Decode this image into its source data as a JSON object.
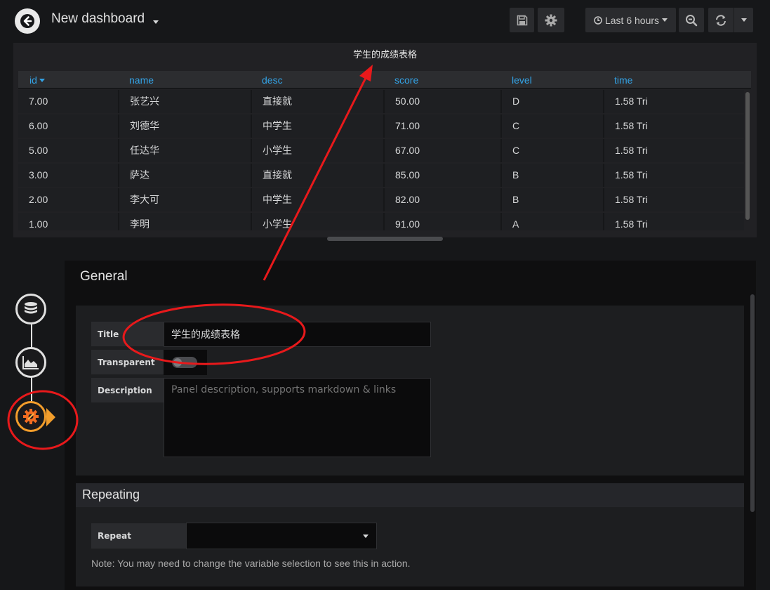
{
  "header": {
    "dashboard_title": "New dashboard",
    "time_range_label": "Last 6 hours"
  },
  "table_panel": {
    "title": "学生的成绩表格",
    "columns": [
      "id",
      "name",
      "desc",
      "score",
      "level",
      "time"
    ],
    "sorted_column": "id",
    "rows": [
      [
        "7.00",
        "张艺兴",
        "直接就",
        "50.00",
        "D",
        "1.58 Tri"
      ],
      [
        "6.00",
        "刘德华",
        "中学生",
        "71.00",
        "C",
        "1.58 Tri"
      ],
      [
        "5.00",
        "任达华",
        "小学生",
        "67.00",
        "C",
        "1.58 Tri"
      ],
      [
        "3.00",
        "萨达",
        "直接就",
        "85.00",
        "B",
        "1.58 Tri"
      ],
      [
        "2.00",
        "李大可",
        "中学生",
        "82.00",
        "B",
        "1.58 Tri"
      ],
      [
        "1.00",
        "李明",
        "小学生",
        "91.00",
        "A",
        "1.58 Tri"
      ]
    ]
  },
  "editor": {
    "heading": "General",
    "general": {
      "title_label": "Title",
      "title_value": "学生的成绩表格",
      "transparent_label": "Transparent",
      "transparent_on": false,
      "description_label": "Description",
      "description_placeholder": "Panel description, supports markdown & links"
    },
    "repeating": {
      "heading": "Repeating",
      "repeat_label": "Repeat",
      "repeat_value": "",
      "note": "Note: You may need to change the variable selection to see this in action."
    }
  },
  "stepper": {
    "steps": [
      "queries",
      "visualization",
      "general"
    ],
    "active_step": "general"
  },
  "colors": {
    "accent_blue": "#33a2e5",
    "active_orange": "#f29d2b",
    "annotation_red": "#e8191b"
  }
}
